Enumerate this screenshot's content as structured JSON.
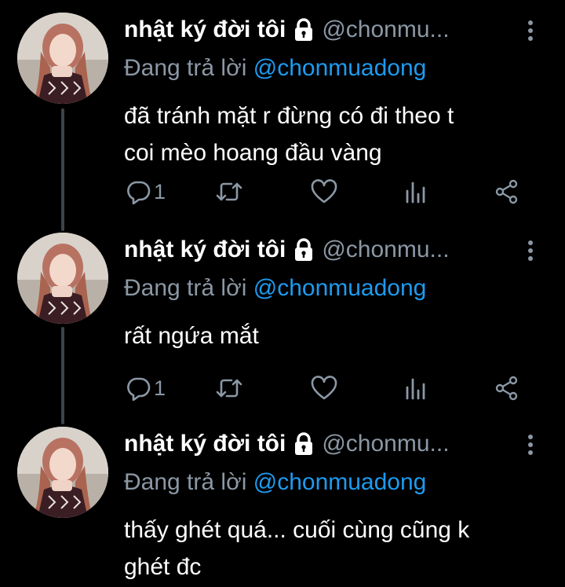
{
  "tweets": [
    {
      "display_name": "nhật ký đời tôi",
      "handle": "@chonmu...",
      "replying_prefix": "Đang trả lời ",
      "replying_to": "@chonmuadong",
      "text_lines": [
        "đã tránh mặt r đừng có đi theo t",
        "coi mèo hoang đầu vàng"
      ],
      "reply_count": "1",
      "retweet_count": "",
      "like_count": ""
    },
    {
      "display_name": "nhật ký đời tôi",
      "handle": "@chonmu...",
      "replying_prefix": "Đang trả lời ",
      "replying_to": "@chonmuadong",
      "text_lines": [
        "rất ngứa mắt"
      ],
      "reply_count": "1",
      "retweet_count": "",
      "like_count": ""
    },
    {
      "display_name": "nhật ký đời tôi",
      "handle": "@chonmu...",
      "replying_prefix": "Đang trả lời ",
      "replying_to": "@chonmuadong",
      "text_lines": [
        "thấy ghét quá... cuối cùng cũng k",
        "ghét đc"
      ],
      "reply_count": "",
      "retweet_count": "",
      "like_count": ""
    }
  ],
  "icons": {
    "verified_lock": "lock-icon",
    "more": "more-vertical-icon",
    "reply": "reply-icon",
    "retweet": "retweet-icon",
    "like": "heart-icon",
    "views": "analytics-icon",
    "share": "share-icon"
  },
  "colors": {
    "background": "#000000",
    "primary_text": "#ffffff",
    "secondary_text": "#8b98a5",
    "mention": "#1d9bf0",
    "thread_line": "#3d4449"
  }
}
